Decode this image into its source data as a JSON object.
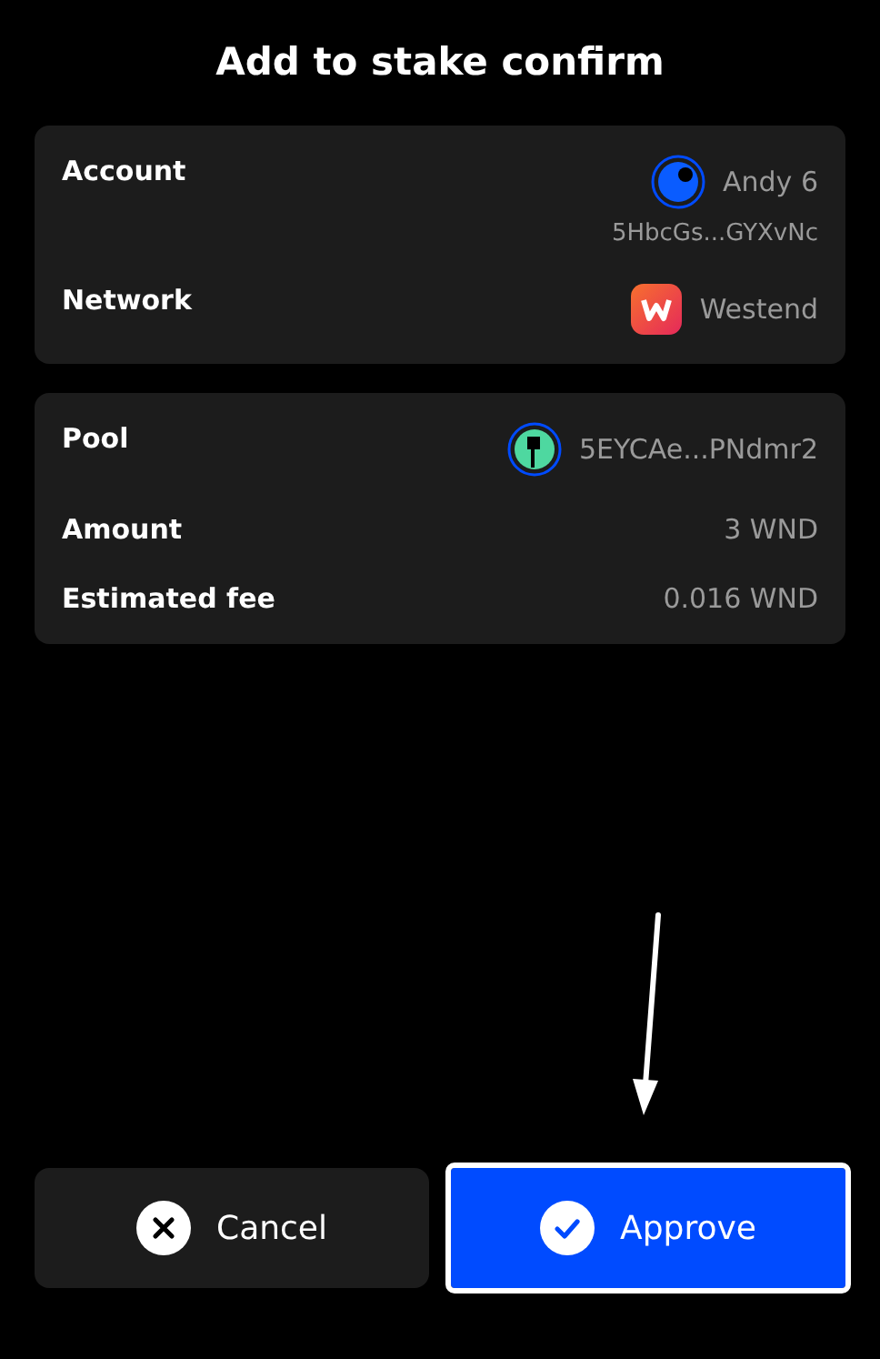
{
  "title": "Add to stake confirm",
  "cards": [
    {
      "rows": [
        {
          "kind": "account",
          "label": "Account",
          "value": "Andy 6",
          "sub": "5HbcGs...GYXvNc"
        },
        {
          "kind": "network",
          "label": "Network",
          "value": "Westend"
        }
      ]
    },
    {
      "rows": [
        {
          "kind": "address",
          "label": "Pool",
          "value": "5EYCAe...PNdmr2"
        },
        {
          "kind": "plain",
          "label": "Amount",
          "value": "3 WND"
        },
        {
          "kind": "plain",
          "label": "Estimated fee",
          "value": "0.016 WND"
        }
      ]
    }
  ],
  "buttons": [
    {
      "kind": "cancel",
      "label": "Cancel",
      "focused": false
    },
    {
      "kind": "approve",
      "label": "Approve",
      "focused": true
    }
  ],
  "annotation": {
    "kind": "arrow"
  }
}
